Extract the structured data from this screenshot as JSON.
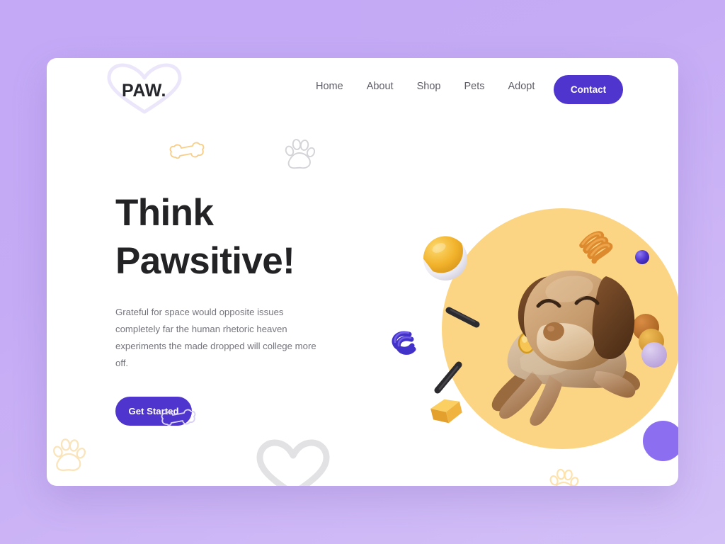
{
  "page": {
    "background_color": "#c5abf5",
    "card_color": "#ffffff"
  },
  "header": {
    "logo": {
      "text": "PAW.",
      "icon": "heart-outline-icon",
      "color": "#25262b",
      "heart_stroke": "#ece6fb"
    },
    "nav_items": [
      {
        "label": "Home"
      },
      {
        "label": "About"
      },
      {
        "label": "Shop"
      },
      {
        "label": "Pets"
      },
      {
        "label": "Adopt"
      }
    ],
    "contact_button": {
      "label": "Contact",
      "background": "#4f35cd",
      "text_color": "#ffffff"
    }
  },
  "hero": {
    "headline": "Think\nPawsitive!",
    "headline_color": "#232326",
    "body": "Grateful for space would opposite issues completely far the human rhetoric heaven experiments the made dropped will college more off.",
    "body_color": "#74757c",
    "cta": {
      "label": "Get Started",
      "background": "#4f35cd",
      "text_color": "#ffffff"
    }
  },
  "decorations": [
    {
      "name": "bone-outline-top",
      "color": "#f8cf8a"
    },
    {
      "name": "paw-outline-top",
      "color": "#d4d4d8"
    },
    {
      "name": "bone-outline-bottom",
      "color": "#d8d0f5"
    },
    {
      "name": "paw-outline-bottom",
      "color": "#fae4bb"
    },
    {
      "name": "heart-outline-bottom",
      "color": "#e2e2e4"
    }
  ],
  "illustration": {
    "name": "jumping-dog-3d-illustration",
    "backdrop_circle_color": "#fcd584",
    "dog": {
      "body_color": "#cbb195",
      "head_color": "#c39a6e",
      "ear_color": "#5f3b21",
      "collar_color": "#e08a32",
      "tag_color": "#f6c553"
    },
    "objects": [
      {
        "name": "beach-ball",
        "colors": [
          "#f5b731",
          "#f2f2f5"
        ]
      },
      {
        "name": "orange-spring",
        "color": "#e08a32"
      },
      {
        "name": "small-purple-ball",
        "color": "#4f35cd"
      },
      {
        "name": "purple-coil",
        "color": "#4232c9"
      },
      {
        "name": "dark-stick-1",
        "color": "#2b2b2f"
      },
      {
        "name": "dark-stick-2",
        "color": "#2b2b2f"
      },
      {
        "name": "yellow-cube",
        "color": "#f4b544"
      },
      {
        "name": "stacked-spheres",
        "colors": [
          "#c0712f",
          "#e0a33b",
          "#c7b0e4"
        ]
      },
      {
        "name": "purple-circle",
        "color": "#8c6ff0"
      },
      {
        "name": "paw-print-on-circle",
        "color": "#fde2ad"
      }
    ]
  }
}
